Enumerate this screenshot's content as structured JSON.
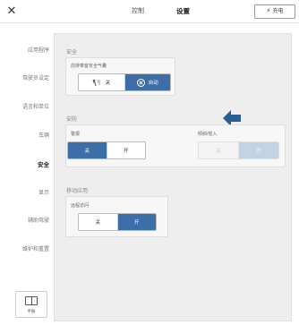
{
  "topbar": {
    "close_glyph": "✕",
    "tabs": [
      {
        "label": "控制"
      },
      {
        "label": "设置"
      }
    ],
    "charge_button": "充电",
    "charge_icon": "bolt-icon"
  },
  "sidebar": {
    "items": [
      {
        "label": "应用程序"
      },
      {
        "label": "驾驶员设定"
      },
      {
        "label": "语言和单位"
      },
      {
        "label": "车辆"
      },
      {
        "label": "安全"
      },
      {
        "label": "显示"
      },
      {
        "label": "辅助驾驶"
      },
      {
        "label": "维护和重置"
      }
    ],
    "active_index": 4,
    "manual_label": "手册"
  },
  "sections": {
    "safety": {
      "title": "安全",
      "passenger_airbag": {
        "label": "前排乘客安全气囊",
        "options": [
          {
            "label": "关"
          },
          {
            "label": "自动"
          }
        ],
        "selected": "自动"
      }
    },
    "security": {
      "title": "安防",
      "alarm": {
        "label": "警报",
        "options": [
          {
            "label": "关"
          },
          {
            "label": "开"
          }
        ],
        "selected": "关"
      },
      "tilt_intrusion": {
        "label": "倾斜/侵入",
        "options": [
          {
            "label": "关"
          },
          {
            "label": "开"
          }
        ],
        "selected": "开",
        "disabled": true
      }
    },
    "mobile_access": {
      "title": "移动应用",
      "remote_access": {
        "label": "远程访问",
        "options": [
          {
            "label": "关"
          },
          {
            "label": "开"
          }
        ],
        "selected": "开"
      }
    }
  },
  "colors": {
    "accent": "#3d6ea8",
    "accent_disabled": "#c2d3e6",
    "pointer_arrow": "#2b5f93"
  }
}
